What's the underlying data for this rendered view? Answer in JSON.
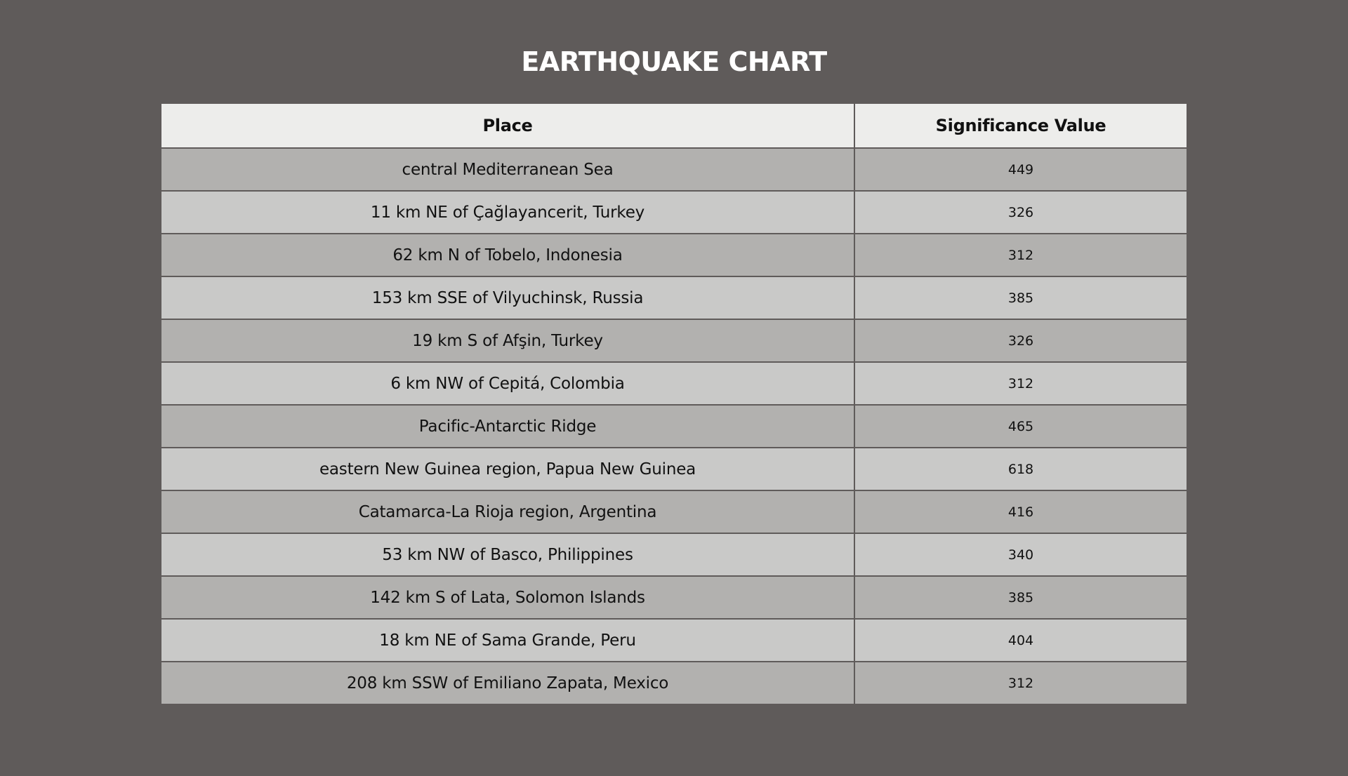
{
  "chart_data": {
    "type": "table",
    "title": "EARTHQUAKE CHART",
    "columns": [
      "Place",
      "Significance Value"
    ],
    "rows": [
      {
        "place": "central Mediterranean Sea",
        "value": "449"
      },
      {
        "place": "11 km NE of Çağlayancerit, Turkey",
        "value": "326"
      },
      {
        "place": "62 km N of Tobelo, Indonesia",
        "value": "312"
      },
      {
        "place": "153 km SSE of Vilyuchinsk, Russia",
        "value": "385"
      },
      {
        "place": "19 km S of Afşin, Turkey",
        "value": "326"
      },
      {
        "place": "6 km NW of Cepitá, Colombia",
        "value": "312"
      },
      {
        "place": "Pacific-Antarctic Ridge",
        "value": "465"
      },
      {
        "place": "eastern New Guinea region, Papua New Guinea",
        "value": "618"
      },
      {
        "place": "Catamarca-La Rioja region, Argentina",
        "value": "416"
      },
      {
        "place": "53 km NW of Basco, Philippines",
        "value": "340"
      },
      {
        "place": "142 km S of Lata, Solomon Islands",
        "value": "385"
      },
      {
        "place": "18 km NE of Sama Grande, Peru",
        "value": "404"
      },
      {
        "place": "208 km SSW of Emiliano Zapata, Mexico",
        "value": "312"
      }
    ]
  },
  "colors": {
    "background": "#5f5b5a",
    "header_row": "#ededeb",
    "row_dark": "#b2b1af",
    "row_light": "#c9c9c8",
    "title_text": "#ffffff"
  }
}
